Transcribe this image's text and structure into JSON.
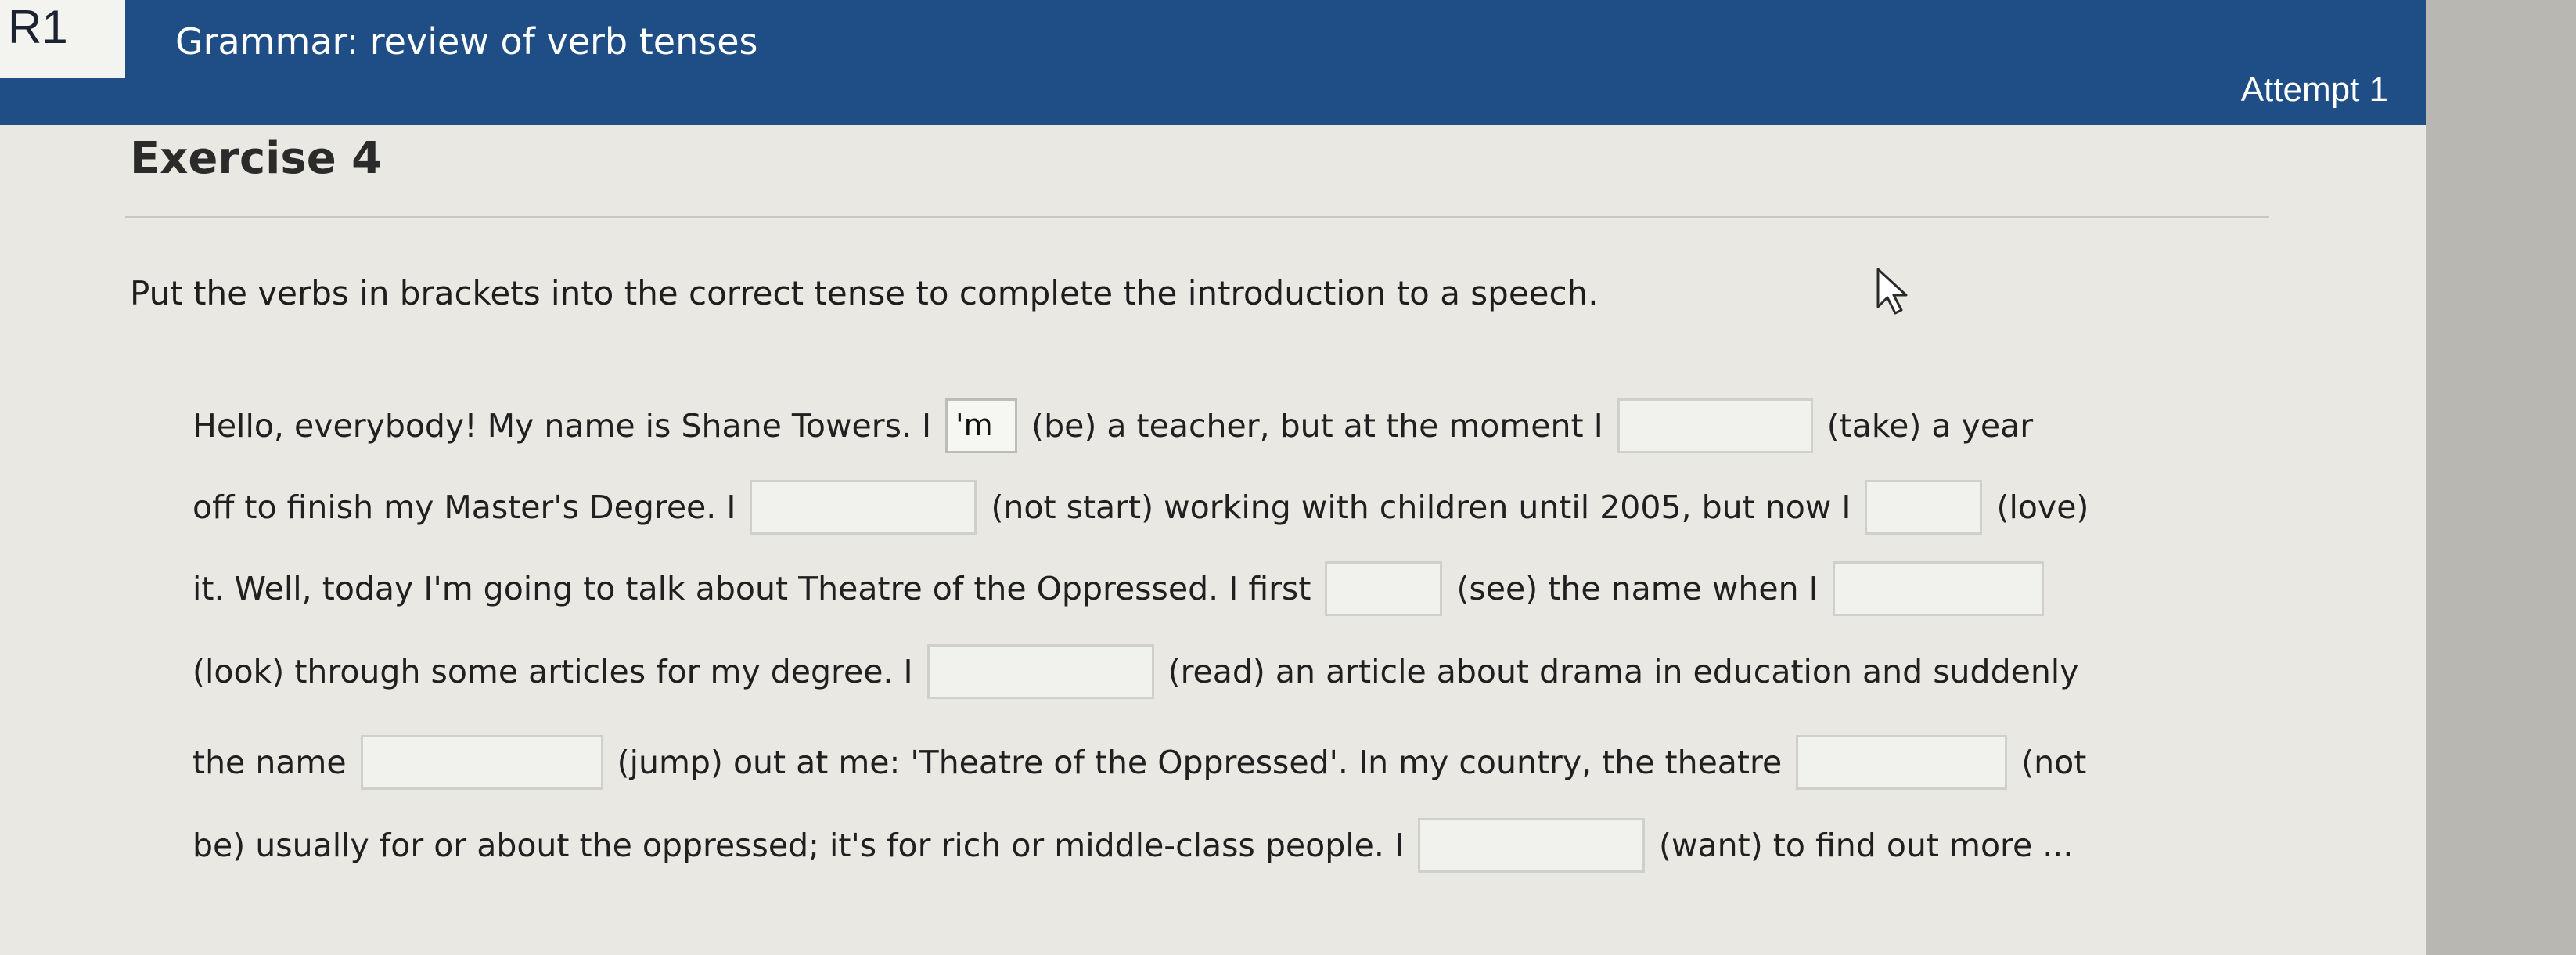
{
  "header": {
    "unit_badge": "R1",
    "unit_title": "Grammar: review of verb tenses",
    "attempt": "Attempt 1"
  },
  "exercise": {
    "title": "Exercise 4",
    "instructions": "Put the verbs in brackets into the correct tense to complete the introduction to a speech."
  },
  "cursor_icon": "arrow-cursor-icon",
  "colors": {
    "header_bar": "#1f4e86",
    "panel": "#e9e8e3",
    "gap_border": "#cfcfcb"
  },
  "lines": [
    {
      "a": "Hello, everybody! My name is Shane Towers. I",
      "gap1": "'m",
      "b": "(be) a teacher, but at the moment I",
      "gap2": "",
      "c": "(take) a year"
    },
    {
      "a": "off to finish my Master's Degree. I",
      "gap1": "",
      "b": "(not start) working with children until 2005, but now I",
      "gap2": "",
      "c": "(love)"
    },
    {
      "a": "it. Well, today I'm going to talk about Theatre of the Oppressed. I first",
      "gap1": "",
      "b": "(see) the name when I",
      "gap2": ""
    },
    {
      "a": "(look) through some articles for my degree. I",
      "gap1": "",
      "b": "(read) an article about drama in education and suddenly"
    },
    {
      "a": "the name",
      "gap1": "",
      "b": "(jump) out at me: 'Theatre of the Oppressed'. In my country, the theatre",
      "gap2": "",
      "c": "(not"
    },
    {
      "a": "be) usually for or about the oppressed; it's for rich or middle-class people. I",
      "gap1": "",
      "b": "(want) to find out more ..."
    }
  ]
}
